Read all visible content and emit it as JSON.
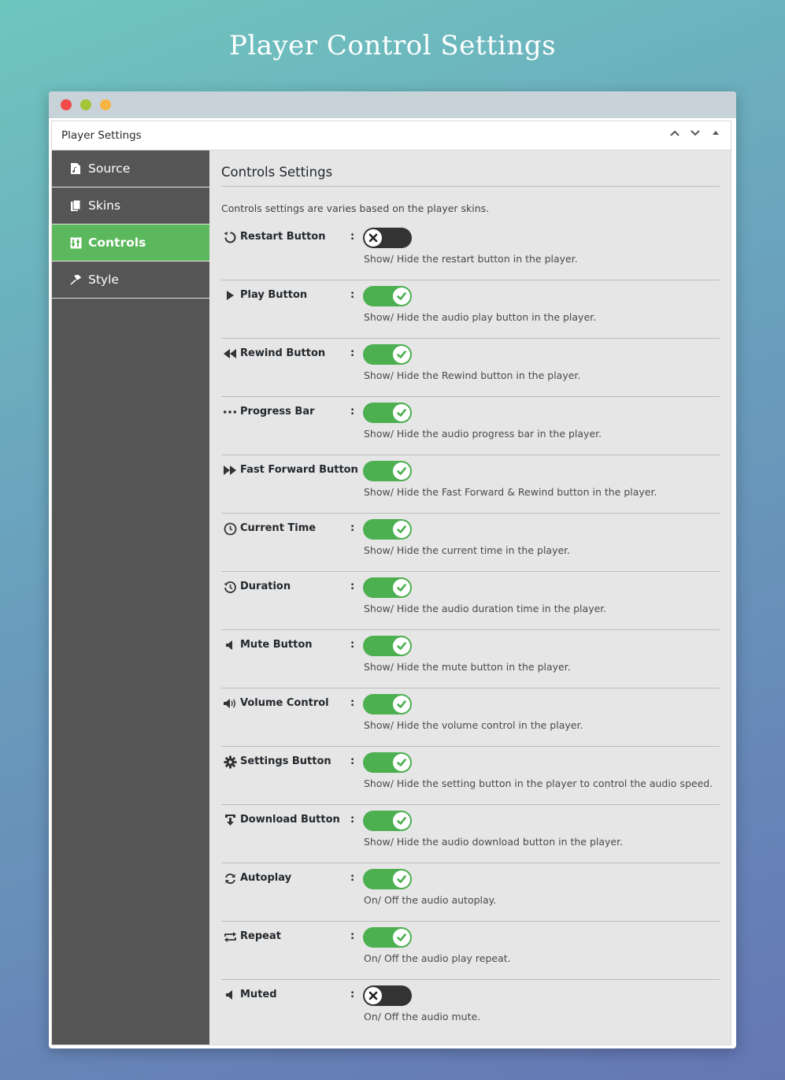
{
  "page_title": "Player Control Settings",
  "panel": {
    "title": "Player Settings",
    "header_icons": [
      "chevron-up-icon",
      "chevron-down-icon",
      "triangle-up-icon"
    ]
  },
  "sidebar": {
    "items": [
      {
        "label": "Source",
        "icon": "music-file-icon",
        "active": false
      },
      {
        "label": "Skins",
        "icon": "copy-pages-icon",
        "active": false
      },
      {
        "label": "Controls",
        "icon": "controls-icon",
        "active": true
      },
      {
        "label": "Style",
        "icon": "brush-icon",
        "active": false
      }
    ]
  },
  "content": {
    "heading": "Controls Settings",
    "description": "Controls settings are varies based on the player skins.",
    "rows": [
      {
        "label": "Restart Button",
        "icon": "restart-icon",
        "on": false,
        "desc": "Show/ Hide the restart button in the player."
      },
      {
        "label": "Play Button",
        "icon": "play-icon",
        "on": true,
        "desc": "Show/ Hide the audio play button in the player."
      },
      {
        "label": "Rewind Button",
        "icon": "rewind-icon",
        "on": true,
        "desc": "Show/ Hide the Rewind button in the player."
      },
      {
        "label": "Progress Bar",
        "icon": "dots-icon",
        "on": true,
        "desc": "Show/ Hide the audio progress bar in the player."
      },
      {
        "label": "Fast Forward Button",
        "icon": "fast-forward-icon",
        "on": true,
        "desc": "Show/ Hide the Fast Forward & Rewind button in the player."
      },
      {
        "label": "Current Time",
        "icon": "clock-icon",
        "on": true,
        "desc": "Show/ Hide the current time in the player."
      },
      {
        "label": "Duration",
        "icon": "history-icon",
        "on": true,
        "desc": "Show/ Hide the audio duration time in the player."
      },
      {
        "label": "Mute Button",
        "icon": "speaker-icon",
        "on": true,
        "desc": "Show/ Hide the mute button in the player."
      },
      {
        "label": "Volume Control",
        "icon": "volume-icon",
        "on": true,
        "desc": "Show/ Hide the volume control in the player."
      },
      {
        "label": "Settings Button",
        "icon": "gear-icon",
        "on": true,
        "desc": "Show/ Hide the setting button in the player to control the audio speed."
      },
      {
        "label": "Download Button",
        "icon": "download-icon",
        "on": true,
        "desc": "Show/ Hide the audio download button in the player."
      },
      {
        "label": "Autoplay",
        "icon": "refresh-icon",
        "on": true,
        "desc": "On/ Off the audio autoplay."
      },
      {
        "label": "Repeat",
        "icon": "repeat-icon",
        "on": true,
        "desc": "On/ Off the audio play repeat."
      },
      {
        "label": "Muted",
        "icon": "speaker-icon",
        "on": false,
        "desc": "On/ Off the audio mute."
      }
    ]
  },
  "colors": {
    "on": "#4caf50",
    "off": "#333333",
    "active_sidebar": "#5cb85c",
    "sidebar_bg": "#555555"
  }
}
